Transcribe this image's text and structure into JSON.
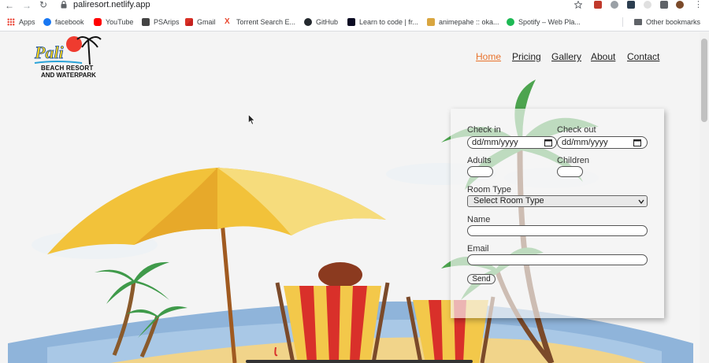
{
  "browser": {
    "url": "paliresort.netlify.app",
    "bookmarks": [
      {
        "label": "Apps",
        "icon": "apps-grid-icon",
        "color": "#ea4335"
      },
      {
        "label": "facebook",
        "icon": "facebook-icon",
        "color": "#1877f2"
      },
      {
        "label": "YouTube",
        "icon": "youtube-icon",
        "color": "#ff0000"
      },
      {
        "label": "PSArips",
        "icon": "psarips-icon",
        "color": "#444444"
      },
      {
        "label": "Gmail",
        "icon": "gmail-icon",
        "color": "#d93025"
      },
      {
        "label": "Torrent Search E...",
        "icon": "torrent-icon",
        "color": "#e8452c"
      },
      {
        "label": "GitHub",
        "icon": "github-icon",
        "color": "#24292e"
      },
      {
        "label": "Learn to code | fr...",
        "icon": "freecodecamp-icon",
        "color": "#0a0a23"
      },
      {
        "label": "animepahe :: oka...",
        "icon": "animepahe-icon",
        "color": "#d9a640"
      },
      {
        "label": "Spotify – Web Pla...",
        "icon": "spotify-icon",
        "color": "#1db954"
      }
    ],
    "other_bookmarks": "Other bookmarks"
  },
  "site": {
    "logo_text": "Pali",
    "logo_line1": "BEACH RESORT",
    "logo_line2": "AND WATERPARK",
    "nav": [
      {
        "label": "Home",
        "active": true
      },
      {
        "label": "Pricing",
        "active": false
      },
      {
        "label": "Gallery",
        "active": false
      },
      {
        "label": "About",
        "active": false
      },
      {
        "label": "Contact",
        "active": false
      }
    ],
    "accent_color": "#e8722c"
  },
  "form": {
    "checkin_label": "Check in",
    "checkin_placeholder": "dd/mm/yyyy",
    "checkout_label": "Check out",
    "checkout_placeholder": "dd/mm/yyyy",
    "adults_label": "Adults",
    "children_label": "Children",
    "room_type_label": "Room Type",
    "room_type_selected": "Select Room Type",
    "name_label": "Name",
    "email_label": "Email",
    "send_label": "Send"
  }
}
